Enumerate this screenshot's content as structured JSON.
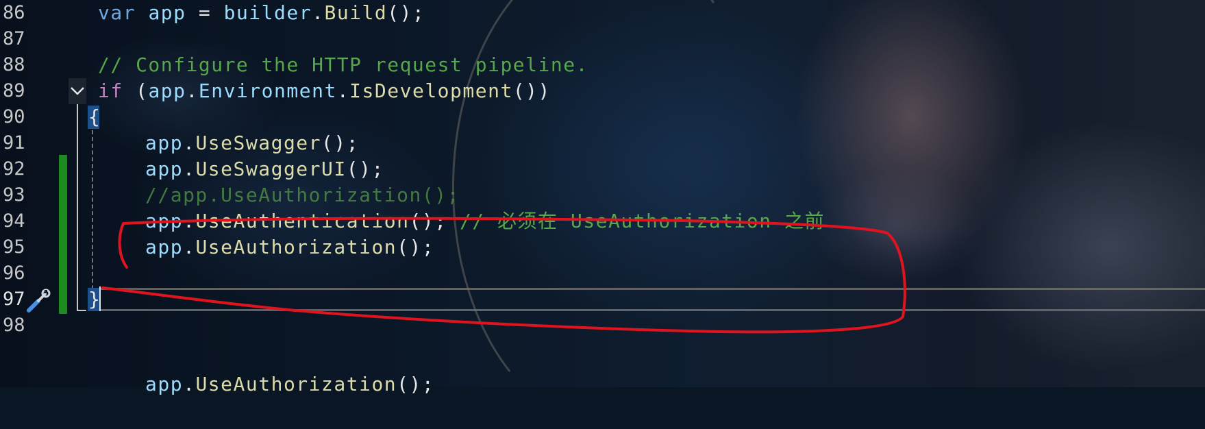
{
  "editor": {
    "line_numbers": [
      "86",
      "87",
      "88",
      "89",
      "90",
      "91",
      "92",
      "93",
      "94",
      "95",
      "96",
      "97",
      "98"
    ],
    "active_line": "97",
    "lines": {
      "l86": {
        "kw": "var",
        "ident": "app",
        "op": " = ",
        "obj": "builder",
        "dot": ".",
        "fn": "Build",
        "tail": "();"
      },
      "l88": {
        "comment": "// Configure the HTTP request pipeline."
      },
      "l89": {
        "kw": "if",
        "open": " (",
        "obj": "app",
        "dot1": ".",
        "prop": "Environment",
        "dot2": ".",
        "fn": "IsDevelopment",
        "tail": "())"
      },
      "l90": {
        "brace": "{"
      },
      "l91": {
        "obj": "app",
        "dot": ".",
        "fn": "UseSwagger",
        "tail": "();"
      },
      "l92": {
        "obj": "app",
        "dot": ".",
        "fn": "UseSwaggerUI",
        "tail": "();"
      },
      "l93": {
        "comment": "//app.UseAuthorization();"
      },
      "l94": {
        "obj": "app",
        "dot": ".",
        "fn": "UseAuthentication",
        "tail": "(); ",
        "comment": "// 必须在 UseAuthorization 之前"
      },
      "l95": {
        "obj": "app",
        "dot": ".",
        "fn": "UseAuthorization",
        "tail": "();"
      },
      "l97": {
        "brace": "}"
      },
      "l99": {
        "obj": "app",
        "dot": ".",
        "fn": "UseAuthorization",
        "tail": "();"
      }
    }
  },
  "colors": {
    "change_bar": "#1d8a20",
    "annotation": "#e0141e",
    "comment": "#57a64a",
    "keyword": "#6fa8e0"
  },
  "icons": {
    "gutter_action": "screwdriver-wrench-icon",
    "fold": "chevron-down-icon"
  }
}
